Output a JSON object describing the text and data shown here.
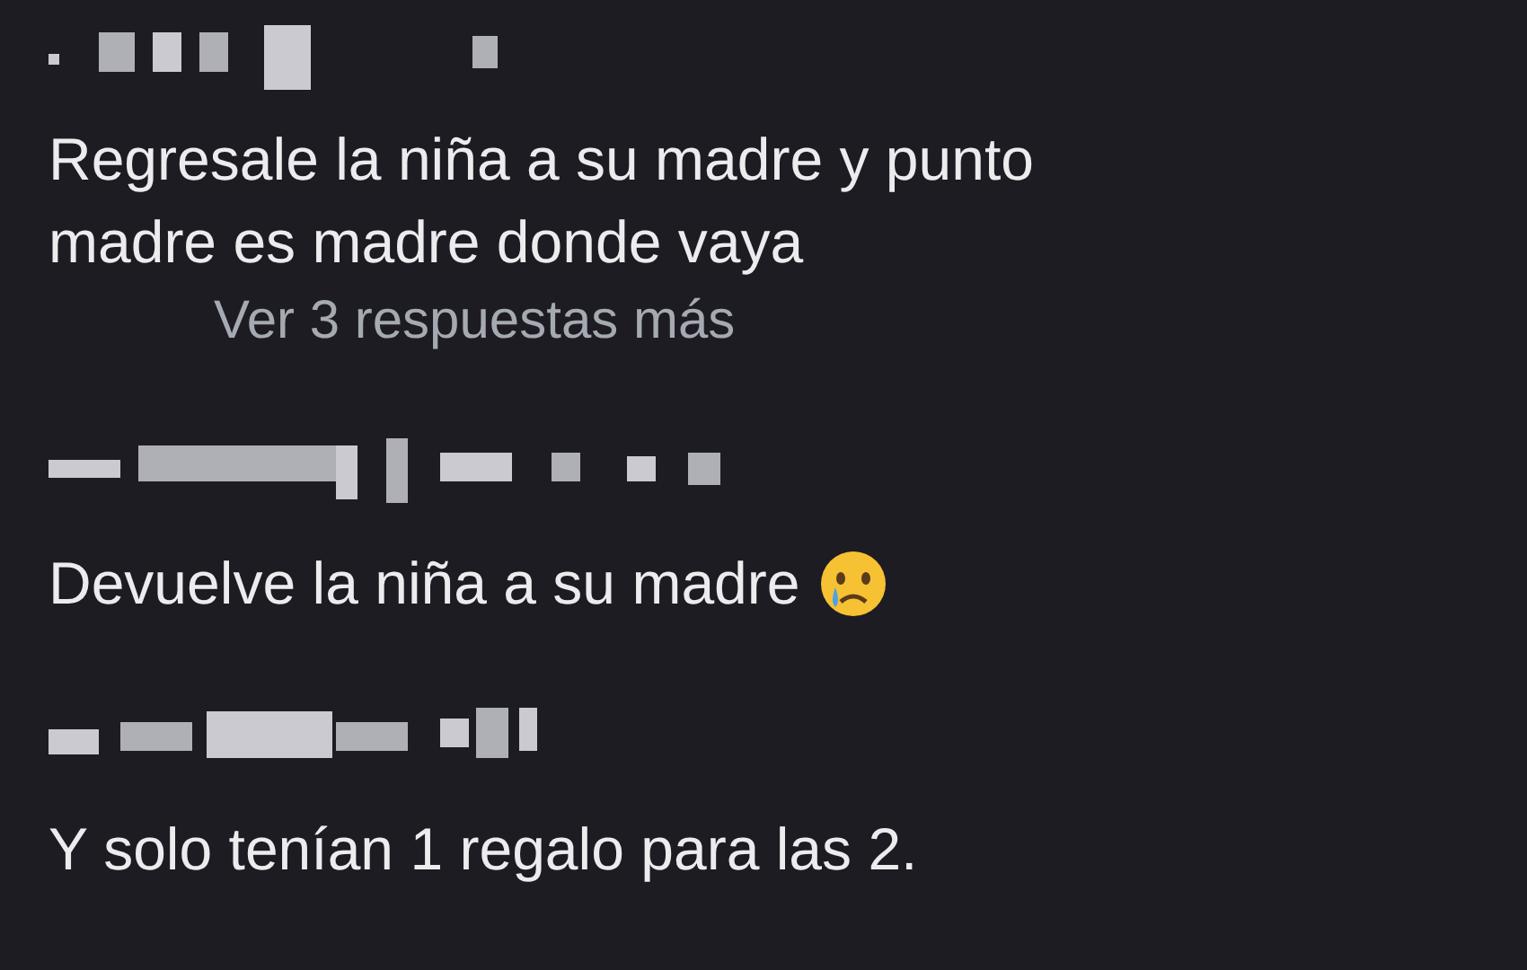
{
  "comments": [
    {
      "kind": "plain",
      "lines": [
        "Regresale la niña a su madre y punto",
        "madre es madre donde vaya"
      ],
      "replies_link": "Ver 3 respuestas más"
    },
    {
      "kind": "emoji",
      "lines": [
        "Devuelve la niña a su madre"
      ]
    },
    {
      "kind": "plain",
      "lines": [
        "Y solo tenían 1 regalo para las 2."
      ]
    }
  ]
}
